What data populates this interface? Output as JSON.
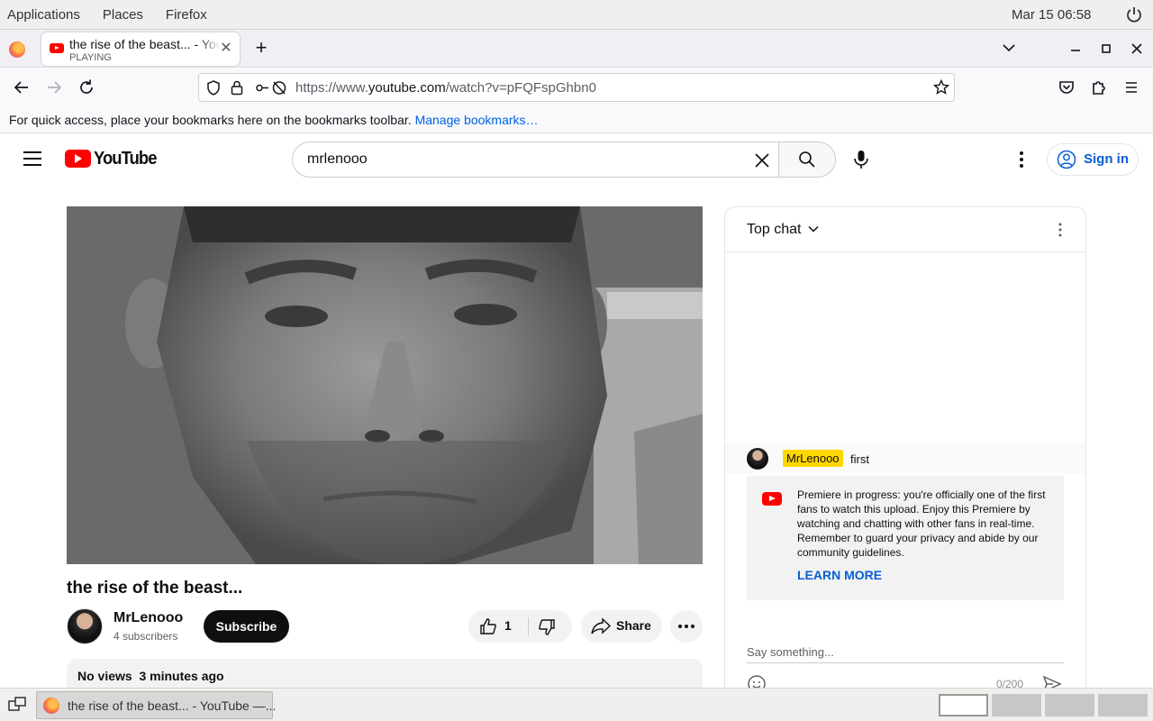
{
  "system": {
    "menus": [
      "Applications",
      "Places",
      "Firefox"
    ],
    "clock": "Mar 15  06:58"
  },
  "browser": {
    "tab": {
      "title": "the rise of the beast... - YouTube",
      "status": "PLAYING"
    },
    "url_prefix": "https://www.",
    "url_domain": "youtube.com",
    "url_path": "/watch?v=pFQFspGhbn0",
    "bookmarks_hint": "For quick access, place your bookmarks here on the bookmarks toolbar.",
    "bookmarks_link": "Manage bookmarks…"
  },
  "youtube": {
    "logo_text": "YouTube",
    "search_value": "mrlenooo",
    "sign_in": "Sign in",
    "video": {
      "title": "the rise of the beast...",
      "channel": "MrLenooo",
      "subscribers": "4 subscribers",
      "subscribe": "Subscribe",
      "likes": "1",
      "share": "Share",
      "meta": "No views  3 minutes ago"
    },
    "chat": {
      "header": "Top chat",
      "message": {
        "author": "MrLenooo",
        "text": "first"
      },
      "banner_text": "Premiere in progress: you're officially one of the first fans to watch this upload. Enjoy this Premiere by watching and chatting with other fans in real-time. Remember to guard your privacy and abide by our community guidelines.",
      "learn_more": "LEARN MORE",
      "placeholder": "Say something...",
      "char_count": "0/200"
    }
  },
  "taskbar": {
    "window_title": "the rise of the beast... - YouTube —..."
  }
}
